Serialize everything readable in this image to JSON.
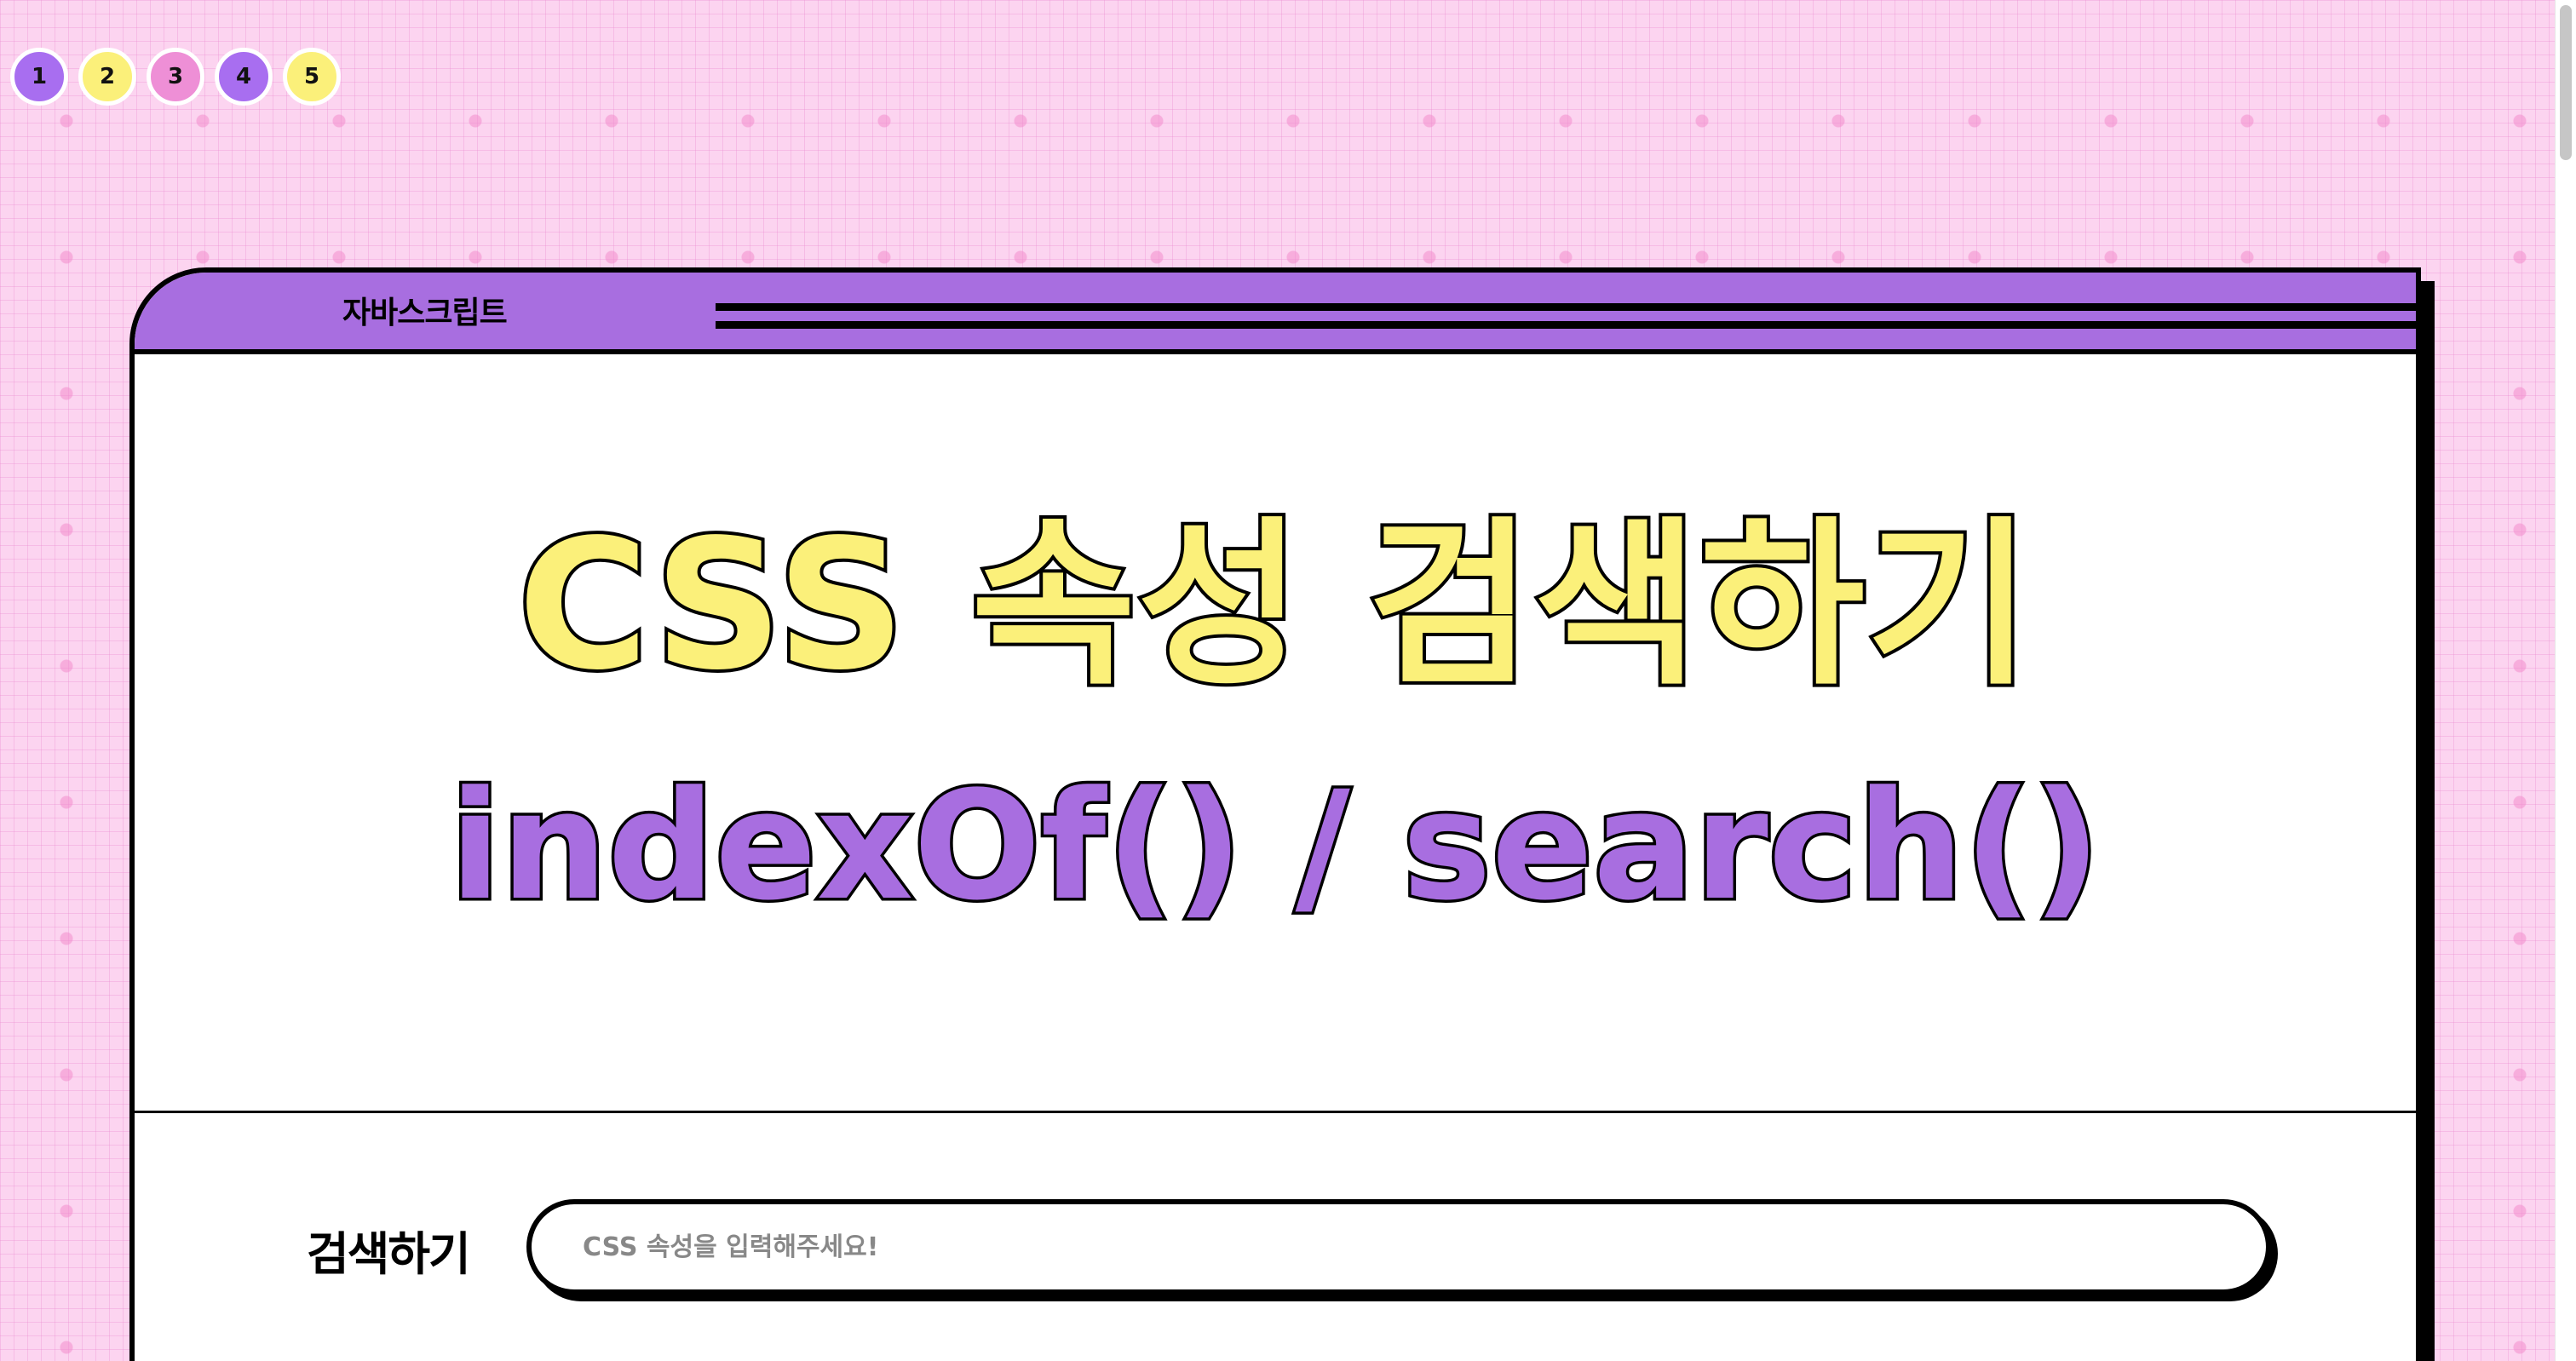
{
  "page_nav": {
    "items": [
      {
        "label": "1",
        "color": "#a86ef0"
      },
      {
        "label": "2",
        "color": "#fbf07a"
      },
      {
        "label": "3",
        "color": "#ee8fd6"
      },
      {
        "label": "4",
        "color": "#a86ef0"
      },
      {
        "label": "5",
        "color": "#fbf07a"
      }
    ]
  },
  "card": {
    "header_label": "자바스크립트",
    "title": "CSS 속성 검색하기",
    "subtitle": "indexOf() / search()"
  },
  "search": {
    "label": "검색하기",
    "placeholder": "CSS 속성을 입력해주세요!",
    "value": ""
  },
  "colors": {
    "background": "#fcd4f0",
    "accent_purple": "#a86ee0",
    "accent_yellow": "#fbf07a",
    "accent_pink": "#ee8fd6"
  }
}
